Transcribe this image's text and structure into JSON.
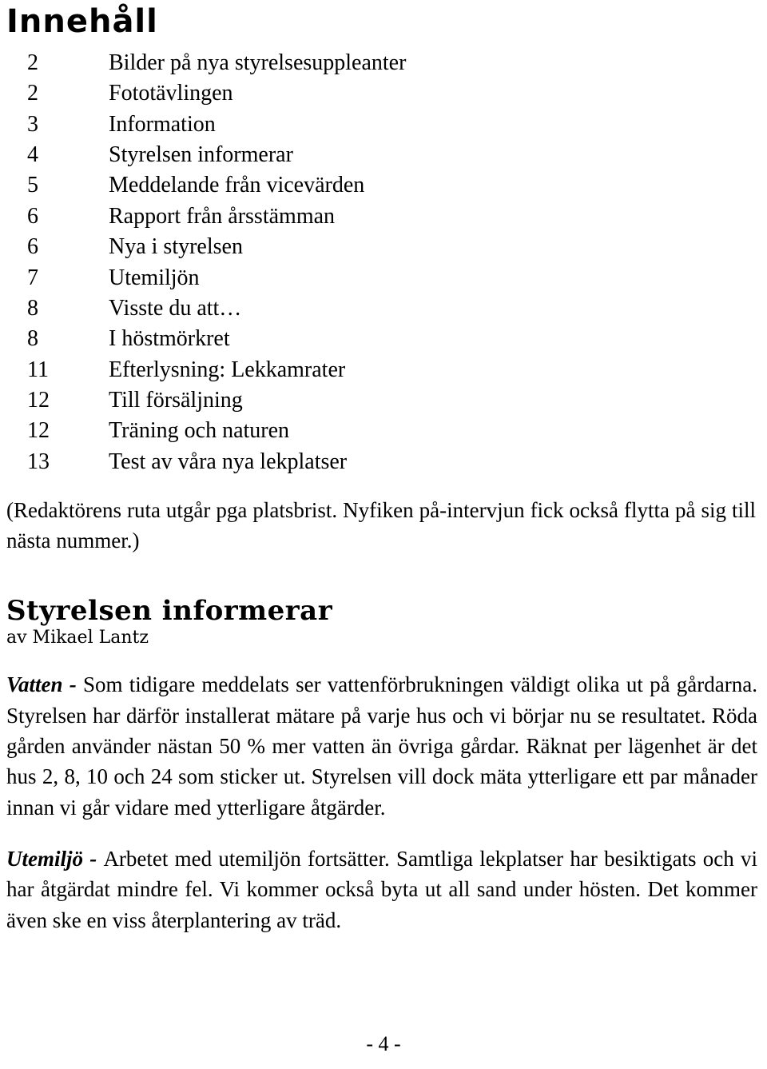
{
  "document": {
    "title": "Innehåll",
    "page_footer": "- 4 -"
  },
  "toc": {
    "entries": [
      {
        "page": "2",
        "label": "Bilder på nya styrelsesuppleanter"
      },
      {
        "page": "2",
        "label": "Fototävlingen"
      },
      {
        "page": "3",
        "label": "Information"
      },
      {
        "page": "4",
        "label": "Styrelsen informerar"
      },
      {
        "page": "5",
        "label": "Meddelande från vicevärden"
      },
      {
        "page": "6",
        "label": "Rapport från årsstämman"
      },
      {
        "page": "6",
        "label": "Nya i styrelsen"
      },
      {
        "page": "7",
        "label": "Utemiljön"
      },
      {
        "page": "8",
        "label": "Visste du att…"
      },
      {
        "page": "8",
        "label": "I höstmörkret"
      },
      {
        "page": "11",
        "label": "Efterlysning: Lekkamrater"
      },
      {
        "page": "12",
        "label": "Till försäljning"
      },
      {
        "page": "12",
        "label": "Träning och naturen"
      },
      {
        "page": "13",
        "label": "Test av våra nya lekplatser"
      }
    ]
  },
  "editor_note": "(Redaktörens ruta utgår pga platsbrist. Nyfiken på-intervjun fick också flytta på sig till nästa nummer.)",
  "article": {
    "heading": "Styrelsen informerar",
    "byline": "av Mikael Lantz",
    "paragraphs": [
      {
        "lead": "Vatten - ",
        "text": "Som tidigare meddelats ser vattenförbrukningen väldigt olika ut på gårdarna. Styrelsen har därför installerat mätare på varje hus och vi börjar nu se resultatet. Röda gården använder nästan 50 % mer vatten än övriga gårdar. Räknat per lägenhet är det hus 2, 8, 10 och 24 som sticker ut. Styrelsen vill dock mäta ytterligare ett par månader innan vi går vidare med ytterligare åtgärder."
      },
      {
        "lead": "Utemiljö - ",
        "text": "Arbetet med utemiljön fortsätter. Samtliga lekplatser har besiktigats och vi har åtgärdat mindre fel. Vi kommer också byta ut all sand under hösten. Det kommer även ske en viss återplantering av träd."
      }
    ]
  }
}
